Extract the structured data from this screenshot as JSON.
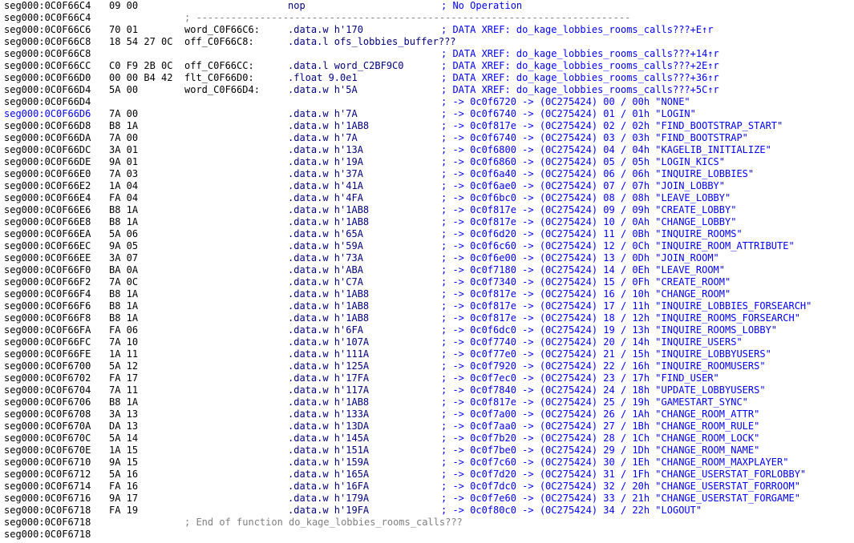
{
  "rows": [
    {
      "addr": "seg000:0C0F66C4",
      "bytes": "09 00",
      "label": "",
      "ins": "nop",
      "cmt": "; No Operation",
      "code": false
    },
    {
      "addr": "seg000:0C0F66C4",
      "bytes": "",
      "label": "",
      "ins": "",
      "cmt": "",
      "sep": "; ---------------------------------------------------------------------------",
      "code": false
    },
    {
      "addr": "seg000:0C0F66C6",
      "bytes": "70 01",
      "label": "word_C0F66C6:",
      "ins": ".data.w h'170",
      "cmt": "; DATA XREF: do_kage_lobbies_rooms_calls???+E↑r",
      "code": false
    },
    {
      "addr": "seg000:0C0F66C8",
      "bytes": "18 54 27 0C",
      "label": "off_C0F66C8:",
      "ins": ".data.l ofs_lobbies_buffer???",
      "cmt": "",
      "code": false
    },
    {
      "addr": "seg000:0C0F66C8",
      "bytes": "",
      "label": "",
      "ins": "",
      "cmt": "; DATA XREF: do_kage_lobbies_rooms_calls???+14↑r",
      "code": false
    },
    {
      "addr": "seg000:0C0F66CC",
      "bytes": "C0 F9 2B 0C",
      "label": "off_C0F66CC:",
      "ins": ".data.l word_C2BF9C0",
      "cmt": "; DATA XREF: do_kage_lobbies_rooms_calls???+2E↑r",
      "code": false
    },
    {
      "addr": "seg000:0C0F66D0",
      "bytes": "00 00 B4 42",
      "label": "flt_C0F66D0:",
      "ins": ".float 9.0e1",
      "cmt": "; DATA XREF: do_kage_lobbies_rooms_calls???+36↑r",
      "code": false
    },
    {
      "addr": "seg000:0C0F66D4",
      "bytes": "5A 00",
      "label": "word_C0F66D4:",
      "ins": ".data.w h'5A",
      "cmt": "; DATA XREF: do_kage_lobbies_rooms_calls???+5C↑r",
      "code": false
    },
    {
      "addr": "seg000:0C0F66D4",
      "bytes": "",
      "label": "",
      "ins": "",
      "cmt": "; -> 0c0f6720 -> (0C275424) 00 / 00h \"NONE\"",
      "code": false
    },
    {
      "addr": "seg000:0C0F66D6",
      "bytes": "7A 00",
      "label": "",
      "ins": ".data.w h'7A",
      "cmt": "; -> 0c0f6740 -> (0C275424) 01 / 01h \"LOGIN\"",
      "code": true
    },
    {
      "addr": "seg000:0C0F66D8",
      "bytes": "B8 1A",
      "label": "",
      "ins": ".data.w h'1AB8",
      "cmt": "; -> 0c0f817e -> (0C275424) 02 / 02h \"FIND_BOOTSTRAP_START\"",
      "code": false
    },
    {
      "addr": "seg000:0C0F66DA",
      "bytes": "7A 00",
      "label": "",
      "ins": ".data.w h'7A",
      "cmt": "; -> 0c0f6740 -> (0C275424) 03 / 03h \"FIND_BOOTSTRAP\"",
      "code": false
    },
    {
      "addr": "seg000:0C0F66DC",
      "bytes": "3A 01",
      "label": "",
      "ins": ".data.w h'13A",
      "cmt": "; -> 0c0f6800 -> (0C275424) 04 / 04h \"KAGELIB_INITIALIZE\"",
      "code": false
    },
    {
      "addr": "seg000:0C0F66DE",
      "bytes": "9A 01",
      "label": "",
      "ins": ".data.w h'19A",
      "cmt": "; -> 0c0f6860 -> (0C275424) 05 / 05h \"LOGIN_KICS\"",
      "code": false
    },
    {
      "addr": "seg000:0C0F66E0",
      "bytes": "7A 03",
      "label": "",
      "ins": ".data.w h'37A",
      "cmt": "; -> 0c0f6a40 -> (0C275424) 06 / 06h \"INQUIRE_LOBBIES\"",
      "code": false
    },
    {
      "addr": "seg000:0C0F66E2",
      "bytes": "1A 04",
      "label": "",
      "ins": ".data.w h'41A",
      "cmt": "; -> 0c0f6ae0 -> (0C275424) 07 / 07h \"JOIN_LOBBY\"",
      "code": false
    },
    {
      "addr": "seg000:0C0F66E4",
      "bytes": "FA 04",
      "label": "",
      "ins": ".data.w h'4FA",
      "cmt": "; -> 0c0f6bc0 -> (0C275424) 08 / 08h \"LEAVE_LOBBY\"",
      "code": false
    },
    {
      "addr": "seg000:0C0F66E6",
      "bytes": "B8 1A",
      "label": "",
      "ins": ".data.w h'1AB8",
      "cmt": "; -> 0c0f817e -> (0C275424) 09 / 09h \"CREATE_LOBBY\"",
      "code": false
    },
    {
      "addr": "seg000:0C0F66E8",
      "bytes": "B8 1A",
      "label": "",
      "ins": ".data.w h'1AB8",
      "cmt": "; -> 0c0f817e -> (0C275424) 10 / 0Ah \"CHANGE_LOBBY\"",
      "code": false
    },
    {
      "addr": "seg000:0C0F66EA",
      "bytes": "5A 06",
      "label": "",
      "ins": ".data.w h'65A",
      "cmt": "; -> 0c0f6d20 -> (0C275424) 11 / 0Bh \"INQUIRE_ROOMS\"",
      "code": false
    },
    {
      "addr": "seg000:0C0F66EC",
      "bytes": "9A 05",
      "label": "",
      "ins": ".data.w h'59A",
      "cmt": "; -> 0c0f6c60 -> (0C275424) 12 / 0Ch \"INQUIRE_ROOM_ATTRIBUTE\"",
      "code": false
    },
    {
      "addr": "seg000:0C0F66EE",
      "bytes": "3A 07",
      "label": "",
      "ins": ".data.w h'73A",
      "cmt": "; -> 0c0f6e00 -> (0C275424) 13 / 0Dh \"JOIN_ROOM\"",
      "code": false
    },
    {
      "addr": "seg000:0C0F66F0",
      "bytes": "BA 0A",
      "label": "",
      "ins": ".data.w h'ABA",
      "cmt": "; -> 0c0f7180 -> (0C275424) 14 / 0Eh \"LEAVE_ROOM\"",
      "code": false
    },
    {
      "addr": "seg000:0C0F66F2",
      "bytes": "7A 0C",
      "label": "",
      "ins": ".data.w h'C7A",
      "cmt": "; -> 0c0f7340 -> (0C275424) 15 / 0Fh \"CREATE_ROOM\"",
      "code": false
    },
    {
      "addr": "seg000:0C0F66F4",
      "bytes": "B8 1A",
      "label": "",
      "ins": ".data.w h'1AB8",
      "cmt": "; -> 0c0f817e -> (0C275424) 16 / 10h \"CHANGE_ROOM\"",
      "code": false
    },
    {
      "addr": "seg000:0C0F66F6",
      "bytes": "B8 1A",
      "label": "",
      "ins": ".data.w h'1AB8",
      "cmt": "; -> 0c0f817e -> (0C275424) 17 / 11h \"INQUIRE_LOBBIES_FORSEARCH\"",
      "code": false
    },
    {
      "addr": "seg000:0C0F66F8",
      "bytes": "B8 1A",
      "label": "",
      "ins": ".data.w h'1AB8",
      "cmt": "; -> 0c0f817e -> (0C275424) 18 / 12h \"INQUIRE_ROOMS_FORSEARCH\"",
      "code": false
    },
    {
      "addr": "seg000:0C0F66FA",
      "bytes": "FA 06",
      "label": "",
      "ins": ".data.w h'6FA",
      "cmt": "; -> 0c0f6dc0 -> (0C275424) 19 / 13h \"INQUIRE_ROOMS_LOBBY\"",
      "code": false
    },
    {
      "addr": "seg000:0C0F66FC",
      "bytes": "7A 10",
      "label": "",
      "ins": ".data.w h'107A",
      "cmt": "; -> 0c0f7740 -> (0C275424) 20 / 14h \"INQUIRE_USERS\"",
      "code": false
    },
    {
      "addr": "seg000:0C0F66FE",
      "bytes": "1A 11",
      "label": "",
      "ins": ".data.w h'111A",
      "cmt": "; -> 0c0f77e0 -> (0C275424) 21 / 15h \"INQUIRE_LOBBYUSERS\"",
      "code": false
    },
    {
      "addr": "seg000:0C0F6700",
      "bytes": "5A 12",
      "label": "",
      "ins": ".data.w h'125A",
      "cmt": "; -> 0c0f7920 -> (0C275424) 22 / 16h \"INQUIRE_ROOMUSERS\"",
      "code": false
    },
    {
      "addr": "seg000:0C0F6702",
      "bytes": "FA 17",
      "label": "",
      "ins": ".data.w h'17FA",
      "cmt": "; -> 0c0f7ec0 -> (0C275424) 23 / 17h \"FIND_USER\"",
      "code": false
    },
    {
      "addr": "seg000:0C0F6704",
      "bytes": "7A 11",
      "label": "",
      "ins": ".data.w h'117A",
      "cmt": "; -> 0c0f7840 -> (0C275424) 24 / 18h \"UPDATE_LOBBYUSERS\"",
      "code": false
    },
    {
      "addr": "seg000:0C0F6706",
      "bytes": "B8 1A",
      "label": "",
      "ins": ".data.w h'1AB8",
      "cmt": "; -> 0c0f817e -> (0C275424) 25 / 19h \"GAMESTART_SYNC\"",
      "code": false
    },
    {
      "addr": "seg000:0C0F6708",
      "bytes": "3A 13",
      "label": "",
      "ins": ".data.w h'133A",
      "cmt": "; -> 0c0f7a00 -> (0C275424) 26 / 1Ah \"CHANGE_ROOM_ATTR\"",
      "code": false
    },
    {
      "addr": "seg000:0C0F670A",
      "bytes": "DA 13",
      "label": "",
      "ins": ".data.w h'13DA",
      "cmt": "; -> 0c0f7aa0 -> (0C275424) 27 / 1Bh \"CHANGE_ROOM_RULE\"",
      "code": false
    },
    {
      "addr": "seg000:0C0F670C",
      "bytes": "5A 14",
      "label": "",
      "ins": ".data.w h'145A",
      "cmt": "; -> 0c0f7b20 -> (0C275424) 28 / 1Ch \"CHANGE_ROOM_LOCK\"",
      "code": false
    },
    {
      "addr": "seg000:0C0F670E",
      "bytes": "1A 15",
      "label": "",
      "ins": ".data.w h'151A",
      "cmt": "; -> 0c0f7be0 -> (0C275424) 29 / 1Dh \"CHANGE_ROOM_NAME\"",
      "code": false
    },
    {
      "addr": "seg000:0C0F6710",
      "bytes": "9A 15",
      "label": "",
      "ins": ".data.w h'159A",
      "cmt": "; -> 0c0f7c60 -> (0C275424) 30 / 1Eh \"CHANGE_ROOM_MAXPLAYER\"",
      "code": false
    },
    {
      "addr": "seg000:0C0F6712",
      "bytes": "5A 16",
      "label": "",
      "ins": ".data.w h'165A",
      "cmt": "; -> 0c0f7d20 -> (0C275424) 31 / 1Fh \"CHANGE_USERSTAT_FORLOBBY\"",
      "code": false
    },
    {
      "addr": "seg000:0C0F6714",
      "bytes": "FA 16",
      "label": "",
      "ins": ".data.w h'16FA",
      "cmt": "; -> 0c0f7dc0 -> (0C275424) 32 / 20h \"CHANGE_USERSTAT_FORROOM\"",
      "code": false
    },
    {
      "addr": "seg000:0C0F6716",
      "bytes": "9A 17",
      "label": "",
      "ins": ".data.w h'179A",
      "cmt": "; -> 0c0f7e60 -> (0C275424) 33 / 21h \"CHANGE_USERSTAT_FORGAME\"",
      "code": false
    },
    {
      "addr": "seg000:0C0F6718",
      "bytes": "FA 19",
      "label": "",
      "ins": ".data.w h'19FA",
      "cmt": "; -> 0c0f80c0 -> (0C275424) 34 / 22h \"LOGOUT\"",
      "code": false
    },
    {
      "addr": "seg000:0C0F6718",
      "bytes": "",
      "label": "",
      "ins": "",
      "cmt": "",
      "fn": "; End of function do_kage_lobbies_rooms_calls???",
      "code": false
    },
    {
      "addr": "seg000:0C0F6718",
      "bytes": "",
      "label": "",
      "ins": "",
      "cmt": "",
      "code": false
    }
  ]
}
